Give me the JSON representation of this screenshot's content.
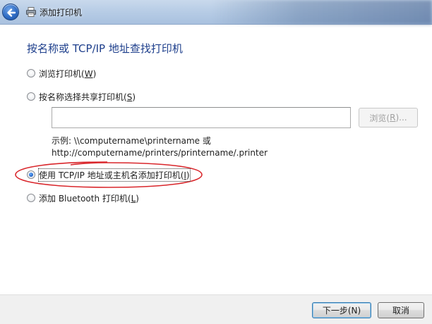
{
  "window": {
    "title": "添加打印机",
    "back_icon": "back-arrow-icon",
    "title_icon": "printer-icon"
  },
  "heading": "按名称或 TCP/IP 地址查找打印机",
  "options": [
    {
      "text": "浏览打印机(",
      "mnemonic": "W",
      "suffix": ")",
      "checked": false
    },
    {
      "text": "按名称选择共享打印机(",
      "mnemonic": "S",
      "suffix": ")",
      "checked": false
    },
    {
      "text": "使用 TCP/IP 地址或主机名添加打印机(",
      "mnemonic": "I",
      "suffix": ")",
      "checked": true
    },
    {
      "text": "添加 Bluetooth 打印机(",
      "mnemonic": "L",
      "suffix": ")",
      "checked": false
    }
  ],
  "shared_printer": {
    "value": "",
    "browse_label": "浏览(",
    "browse_mnemonic": "R",
    "browse_suffix": ")..."
  },
  "example": {
    "line1": "示例: \\\\computername\\printername 或",
    "line2": "http://computername/printers/printername/.printer"
  },
  "footer": {
    "next_label": "下一步(N)",
    "cancel_label": "取消"
  },
  "colors": {
    "heading": "#1e3f8c",
    "annotation_ellipse": "#d9262b"
  }
}
